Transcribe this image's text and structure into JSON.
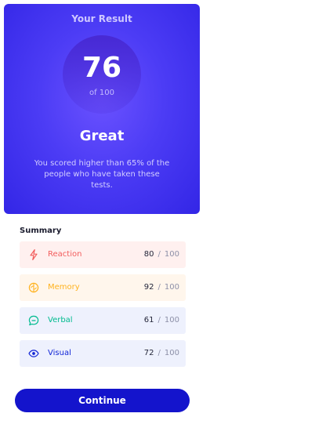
{
  "result": {
    "heading": "Your Result",
    "score": "76",
    "score_of": "of 100",
    "rating": "Great",
    "description": "You scored higher than 65% of the people who have taken these tests."
  },
  "summary": {
    "title": "Summary",
    "items": [
      {
        "label": "Reaction",
        "score": "80",
        "max": "100",
        "icon": "lightning-icon",
        "color": "#f25c5c",
        "bg": "#fff0ef"
      },
      {
        "label": "Memory",
        "score": "92",
        "max": "100",
        "icon": "brain-icon",
        "color": "#ffb21e",
        "bg": "#fff6ec"
      },
      {
        "label": "Verbal",
        "score": "61",
        "max": "100",
        "icon": "chat-bubble-icon",
        "color": "#00bb8f",
        "bg": "#eef1fd"
      },
      {
        "label": "Visual",
        "score": "72",
        "max": "100",
        "icon": "eye-icon",
        "color": "#1125d6",
        "bg": "#eef1fd"
      }
    ]
  },
  "continue_label": "Continue"
}
